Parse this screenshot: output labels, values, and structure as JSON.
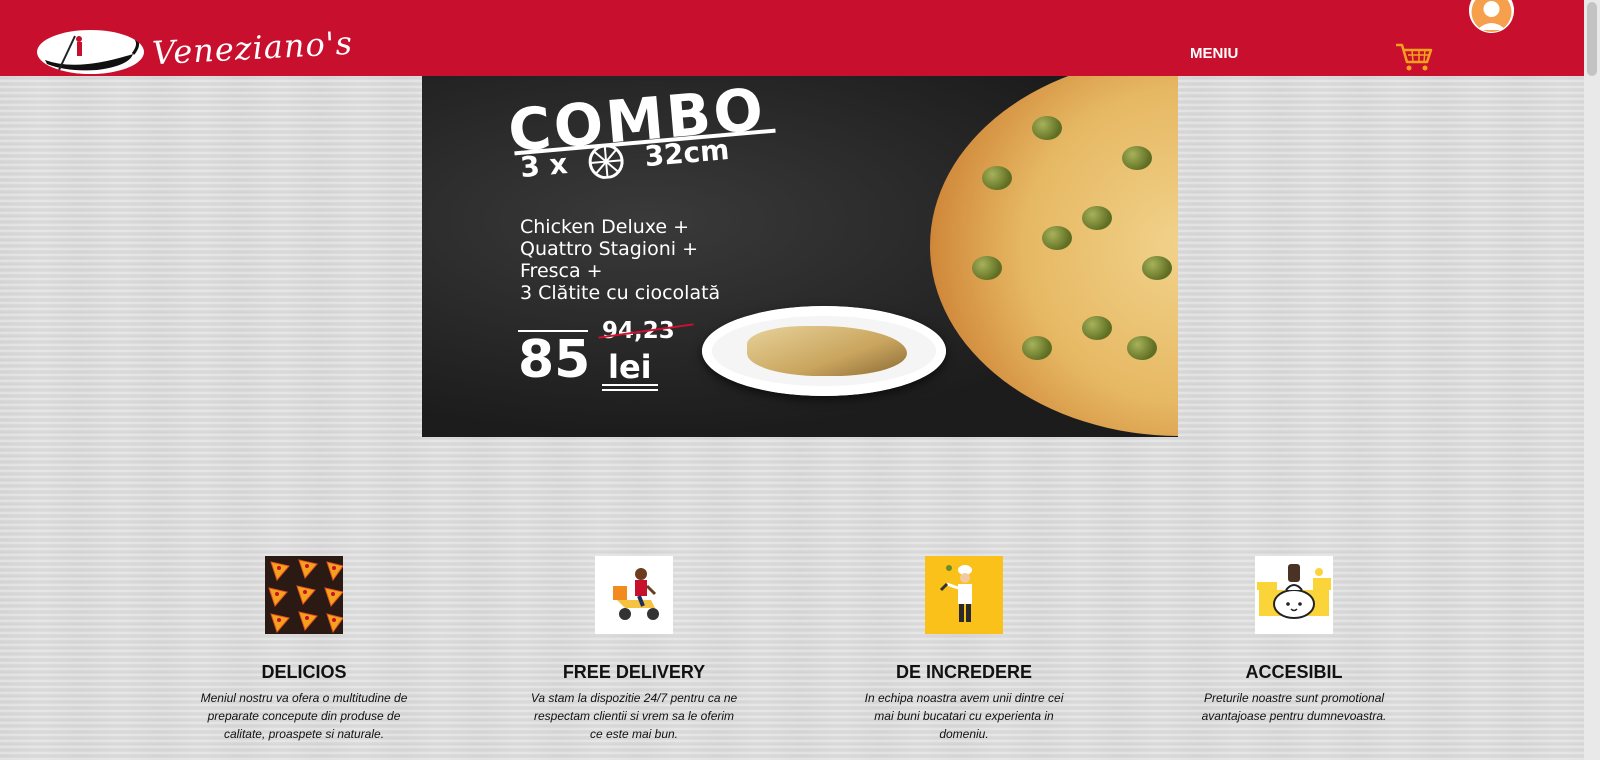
{
  "brand": {
    "name": "Veneziano's",
    "accent_color": "#c8102e",
    "logo_icon": "gondola-icon"
  },
  "nav": {
    "menu_label": "MENIU",
    "cart_icon": "cart-icon",
    "avatar_icon": "user-avatar-icon"
  },
  "banner": {
    "title": "COMBO",
    "subtitle_prefix": "3 x",
    "subtitle_suffix": "32cm",
    "items": [
      "Chicken Deluxe +",
      "Quattro Stagioni +",
      "Fresca +",
      "3 Clătite cu ciocolată"
    ],
    "old_price": "94,23",
    "new_price": "85",
    "currency": "lei"
  },
  "features": [
    {
      "icon": "pizza-slices-icon",
      "title": "DELICIOS",
      "text": "Meniul nostru va ofera o multitudine de preparate concepute din produse de calitate, proaspete si naturale."
    },
    {
      "icon": "delivery-scooter-icon",
      "title": "FREE DELIVERY",
      "text": "Va stam la dispozitie 24/7 pentru ca ne respectam clientii si vrem sa le oferim ce este mai bun."
    },
    {
      "icon": "chef-icon",
      "title": "DE INCREDERE",
      "text": "In echipa noastra avem unii dintre cei mai buni bucatari cu experienta in domeniu."
    },
    {
      "icon": "money-bag-icon",
      "title": "ACCESIBIL",
      "text": "Preturile noastre sunt promotional avantajoase pentru dumnevoastra."
    }
  ]
}
